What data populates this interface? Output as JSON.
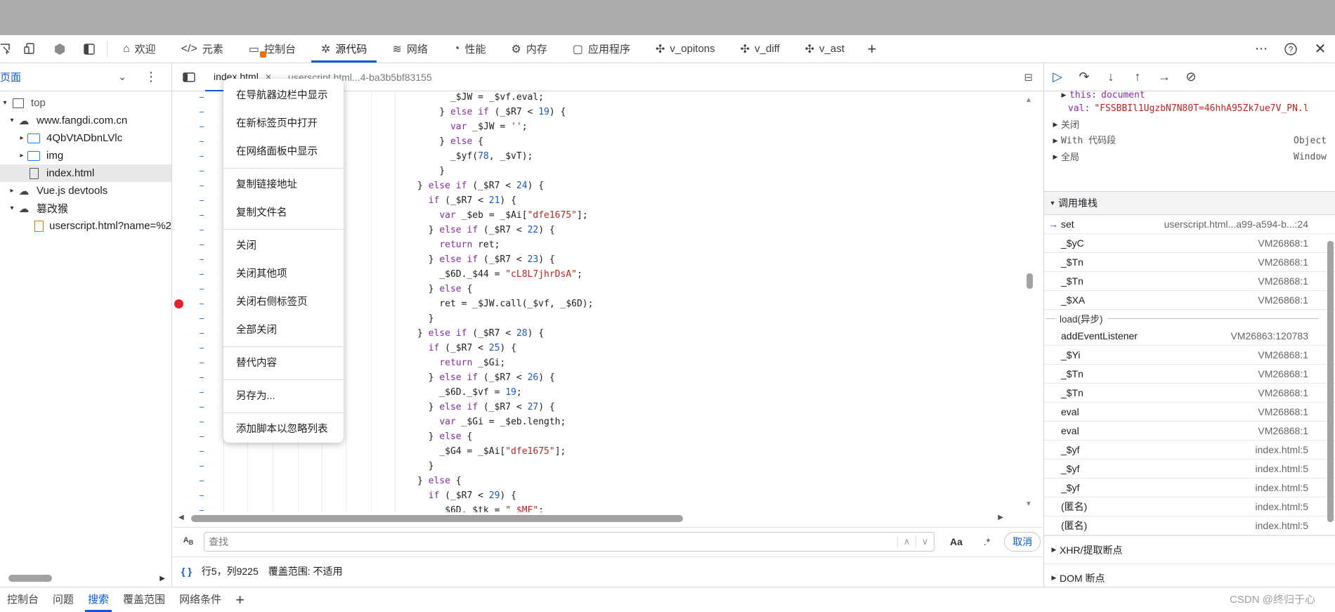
{
  "main_tabs": {
    "items": [
      {
        "label": "欢迎",
        "icon": "home-icon"
      },
      {
        "label": "元素",
        "icon": "code-tag-icon"
      },
      {
        "label": "控制台",
        "icon": "console-icon"
      },
      {
        "label": "源代码",
        "icon": "bug-icon"
      },
      {
        "label": "网络",
        "icon": "wifi-icon"
      },
      {
        "label": "性能",
        "icon": "gauge-icon"
      },
      {
        "label": "内存",
        "icon": "chip-icon"
      },
      {
        "label": "应用程序",
        "icon": "app-window-icon"
      },
      {
        "label": "v_opitons",
        "icon": "puzzle-icon"
      },
      {
        "label": "v_diff",
        "icon": "puzzle-icon"
      },
      {
        "label": "v_ast",
        "icon": "puzzle-icon"
      }
    ],
    "active": "源代码",
    "accent": "#0c59d6"
  },
  "navigator": {
    "header": "页面",
    "tree": [
      {
        "label": "top",
        "icon": "frame-icon"
      },
      {
        "label": "www.fangdi.com.cn",
        "icon": "cloud-icon"
      },
      {
        "label": "4QbVtADbnLVlc",
        "icon": "folder-icon"
      },
      {
        "label": "img",
        "icon": "folder-icon"
      },
      {
        "label": "index.html",
        "icon": "file-icon"
      },
      {
        "label": "Vue.js devtools",
        "icon": "cloud-icon"
      },
      {
        "label": "篡改猴",
        "icon": "cloud-icon"
      },
      {
        "label": "userscript.html?name=%2",
        "icon": "file-icon"
      }
    ]
  },
  "editor": {
    "tabs": [
      {
        "label": "index.html",
        "close": "×"
      },
      {
        "label": "userscript.html...4-ba3b5bf83155"
      }
    ],
    "code_lines": [
      [
        [
          "      _$JW = _$vf.eval;",
          ""
        ]
      ],
      [
        [
          "    } ",
          ""
        ],
        [
          "else if",
          "kw"
        ],
        [
          " (_$R7 < ",
          ""
        ],
        [
          "19",
          "num"
        ],
        [
          ") {",
          ""
        ]
      ],
      [
        [
          "      ",
          ""
        ],
        [
          "var",
          "kw"
        ],
        [
          " _$JW = ",
          ""
        ],
        [
          "''",
          "str"
        ],
        [
          ";",
          ""
        ]
      ],
      [
        [
          "    } ",
          ""
        ],
        [
          "else",
          "kw"
        ],
        [
          " {",
          ""
        ]
      ],
      [
        [
          "      _$yf(",
          ""
        ],
        [
          "78",
          "num"
        ],
        [
          ", _$vT);",
          ""
        ]
      ],
      [
        [
          "    }",
          ""
        ]
      ],
      [
        [
          "} ",
          ""
        ],
        [
          "else if",
          "kw"
        ],
        [
          " (_$R7 < ",
          ""
        ],
        [
          "24",
          "num"
        ],
        [
          ") {",
          ""
        ]
      ],
      [
        [
          "  ",
          ""
        ],
        [
          "if",
          "kw"
        ],
        [
          " (_$R7 < ",
          ""
        ],
        [
          "21",
          "num"
        ],
        [
          ") {",
          ""
        ]
      ],
      [
        [
          "    ",
          ""
        ],
        [
          "var",
          "kw"
        ],
        [
          " _$eb = _$Ai[",
          ""
        ],
        [
          "\"dfe1675\"",
          "str"
        ],
        [
          "];",
          ""
        ]
      ],
      [
        [
          "  } ",
          ""
        ],
        [
          "else if",
          "kw"
        ],
        [
          " (_$R7 < ",
          ""
        ],
        [
          "22",
          "num"
        ],
        [
          ") {",
          ""
        ]
      ],
      [
        [
          "    ",
          ""
        ],
        [
          "return",
          "kw"
        ],
        [
          " ret;",
          ""
        ]
      ],
      [
        [
          "  } ",
          ""
        ],
        [
          "else if",
          "kw"
        ],
        [
          " (_$R7 < ",
          ""
        ],
        [
          "23",
          "num"
        ],
        [
          ") {",
          ""
        ]
      ],
      [
        [
          "    _$6D._$44 = ",
          ""
        ],
        [
          "\"cL8L7jhrDsA\"",
          "str"
        ],
        [
          ";",
          ""
        ]
      ],
      [
        [
          "  } ",
          ""
        ],
        [
          "else",
          "kw"
        ],
        [
          " {",
          ""
        ]
      ],
      [
        [
          "    ret = _$JW.call(_$vf, _$6D);",
          ""
        ]
      ],
      [
        [
          "  }",
          ""
        ]
      ],
      [
        [
          "} ",
          ""
        ],
        [
          "else if",
          "kw"
        ],
        [
          " (_$R7 < ",
          ""
        ],
        [
          "28",
          "num"
        ],
        [
          ") {",
          ""
        ]
      ],
      [
        [
          "  ",
          ""
        ],
        [
          "if",
          "kw"
        ],
        [
          " (_$R7 < ",
          ""
        ],
        [
          "25",
          "num"
        ],
        [
          ") {",
          ""
        ]
      ],
      [
        [
          "    ",
          ""
        ],
        [
          "return",
          "kw"
        ],
        [
          " _$Gi;",
          ""
        ]
      ],
      [
        [
          "  } ",
          ""
        ],
        [
          "else if",
          "kw"
        ],
        [
          " (_$R7 < ",
          ""
        ],
        [
          "26",
          "num"
        ],
        [
          ") {",
          ""
        ]
      ],
      [
        [
          "    _$6D._$vf = ",
          ""
        ],
        [
          "19",
          "num"
        ],
        [
          ";",
          ""
        ]
      ],
      [
        [
          "  } ",
          ""
        ],
        [
          "else if",
          "kw"
        ],
        [
          " (_$R7 < ",
          ""
        ],
        [
          "27",
          "num"
        ],
        [
          ") {",
          ""
        ]
      ],
      [
        [
          "    ",
          ""
        ],
        [
          "var",
          "kw"
        ],
        [
          " _$Gi = _$eb.length;",
          ""
        ]
      ],
      [
        [
          "  } ",
          ""
        ],
        [
          "else",
          "kw"
        ],
        [
          " {",
          ""
        ]
      ],
      [
        [
          "    _$G4 = _$Ai[",
          ""
        ],
        [
          "\"dfe1675\"",
          "str"
        ],
        [
          "];",
          ""
        ]
      ],
      [
        [
          "  }",
          ""
        ]
      ],
      [
        [
          "} ",
          ""
        ],
        [
          "else",
          "kw"
        ],
        [
          " {",
          ""
        ]
      ],
      [
        [
          "  ",
          ""
        ],
        [
          "if",
          "kw"
        ],
        [
          " (_$R7 < ",
          ""
        ],
        [
          "29",
          "num"
        ],
        [
          ") {",
          ""
        ]
      ],
      [
        [
          "    _$6D._$tk = ",
          ""
        ],
        [
          "\"_$MF\"",
          "str"
        ],
        [
          ";",
          ""
        ]
      ]
    ],
    "breakpoint_line": 14,
    "search": {
      "placeholder": "查找",
      "match_case": "Aa",
      "regex": ".*",
      "cancel": "取消"
    },
    "status": {
      "braces": "{ }",
      "position": "行5，列9225",
      "coverage": "覆盖范围: 不适用"
    }
  },
  "context_menu": {
    "groups": [
      [
        "在导航器边栏中显示",
        "在新标签页中打开",
        "在网络面板中显示"
      ],
      [
        "复制链接地址",
        "复制文件名"
      ],
      [
        "关闭",
        "关闭其他项",
        "关闭右侧标签页",
        "全部关闭"
      ],
      [
        "替代内容"
      ],
      [
        "另存为..."
      ],
      [
        "添加脚本以忽略列表"
      ]
    ]
  },
  "debugger": {
    "scope": {
      "this_key": "this:",
      "this_val": "document",
      "val_key": "val:",
      "val_val": "\"FSSBBIl1UgzbN7N80T=46hhA95Zk7ue7V_PN.l",
      "closure": "关闭",
      "with_label": "With 代码段",
      "with_type": "Object",
      "global_label": "全局",
      "global_type": "Window"
    },
    "callstack_title": "调用堆栈",
    "frames_sync": [
      {
        "name": "set",
        "loc": "userscript.html...a99-a594-b...:24",
        "current": true
      },
      {
        "name": "_$yC",
        "loc": "VM26868:1"
      },
      {
        "name": "_$Tn",
        "loc": "VM26868:1"
      },
      {
        "name": "_$Tn",
        "loc": "VM26868:1"
      },
      {
        "name": "_$XA",
        "loc": "VM26868:1"
      }
    ],
    "async_label": "load(异步)",
    "frames_async": [
      {
        "name": "addEventListener",
        "loc": "VM26863:120783"
      },
      {
        "name": "_$Yi",
        "loc": "VM26868:1"
      },
      {
        "name": "_$Tn",
        "loc": "VM26868:1"
      },
      {
        "name": "_$Tn",
        "loc": "VM26868:1"
      },
      {
        "name": "eval",
        "loc": "VM26868:1"
      },
      {
        "name": "eval",
        "loc": "VM26868:1"
      },
      {
        "name": "_$yf",
        "loc": "index.html:5"
      },
      {
        "name": "_$yf",
        "loc": "index.html:5"
      },
      {
        "name": "_$yf",
        "loc": "index.html:5"
      },
      {
        "name": "(匿名)",
        "loc": "index.html:5"
      },
      {
        "name": "(匿名)",
        "loc": "index.html:5"
      }
    ],
    "xhr_section": "XHR/提取断点",
    "dom_section": "DOM 断点"
  },
  "drawer": {
    "tabs": [
      "控制台",
      "问题",
      "搜索",
      "覆盖范围",
      "网络条件"
    ],
    "active": "搜索",
    "add": "+"
  },
  "watermark": "CSDN @终归于心"
}
